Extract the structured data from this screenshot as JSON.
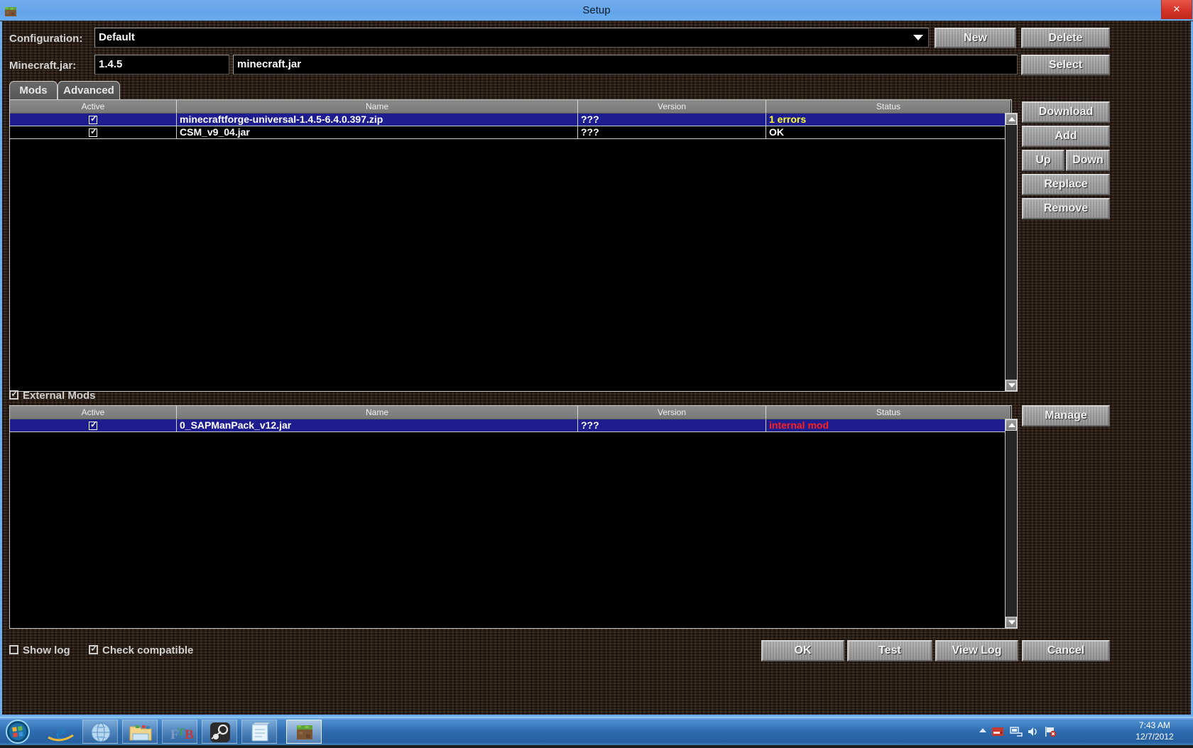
{
  "window": {
    "title": "Setup",
    "icon": "minecraft-grass-block-icon",
    "close_label": "×"
  },
  "form": {
    "configuration_label": "Configuration:",
    "configuration_value": "Default",
    "minecraft_jar_label": "Minecraft.jar:",
    "version_value": "1.4.5",
    "jar_value": "minecraft.jar",
    "new_label": "New",
    "delete_label": "Delete",
    "select_label": "Select"
  },
  "tabs": [
    {
      "label": "Mods",
      "active": true
    },
    {
      "label": "Advanced",
      "active": false
    }
  ],
  "mods_table": {
    "columns": [
      "Active",
      "Name",
      "Version",
      "Status"
    ],
    "rows": [
      {
        "active": true,
        "name": "minecraftforge-universal-1.4.5-6.4.0.397.zip",
        "version": "???",
        "status": "1 errors",
        "status_color": "#ffff33",
        "selected": true
      },
      {
        "active": true,
        "name": "CSM_v9_04.jar",
        "version": "???",
        "status": "OK",
        "status_color": "#ffffff",
        "selected": false
      }
    ]
  },
  "mods_buttons": [
    {
      "label": "Download"
    },
    {
      "label": "Add"
    },
    {
      "label": "Up"
    },
    {
      "label": "Down"
    },
    {
      "label": "Replace"
    },
    {
      "label": "Remove"
    }
  ],
  "external_mods": {
    "label": "External Mods",
    "checked": true,
    "columns": [
      "Active",
      "Name",
      "Version",
      "Status"
    ],
    "rows": [
      {
        "active": true,
        "name": "0_SAPManPack_v12.jar",
        "version": "???",
        "status": "internal mod",
        "status_color": "#ff2020",
        "selected": true
      }
    ],
    "manage_label": "Manage"
  },
  "footer": {
    "show_log_label": "Show log",
    "show_log_checked": false,
    "check_compatible_label": "Check compatible",
    "check_compatible_checked": true,
    "ok_label": "OK",
    "test_label": "Test",
    "view_log_label": "View Log",
    "cancel_label": "Cancel"
  },
  "taskbar": {
    "start_icon": "windows-start-orb-icon",
    "items": [
      {
        "icon": "internet-explorer-icon",
        "name": "internet-explorer"
      },
      {
        "icon": "globe-browser-icon",
        "name": "browser-globe"
      },
      {
        "icon": "folder-explorer-icon",
        "name": "windows-explorer"
      },
      {
        "icon": "ftb-launcher-icon",
        "name": "feed-the-beast-launcher",
        "text": "FTB"
      },
      {
        "icon": "steam-icon",
        "name": "steam"
      },
      {
        "icon": "notepad-icon",
        "name": "notepad"
      },
      {
        "icon": "minecraft-grass-block-icon",
        "name": "minecraft",
        "active": true
      }
    ],
    "tray": {
      "show_hidden_icon": "chevron-up-icon",
      "removable_media_icon": "removable-media-icon",
      "network_icon": "network-icon",
      "volume_icon": "volume-icon",
      "action_center_icon": "flag-alert-icon",
      "time": "7:43 AM",
      "date": "12/7/2012"
    }
  },
  "colors": {
    "selection_blue": "#1d1d8f",
    "title_blue": "#6badef",
    "error_yellow": "#ffff33",
    "internal_red": "#ff2020"
  }
}
